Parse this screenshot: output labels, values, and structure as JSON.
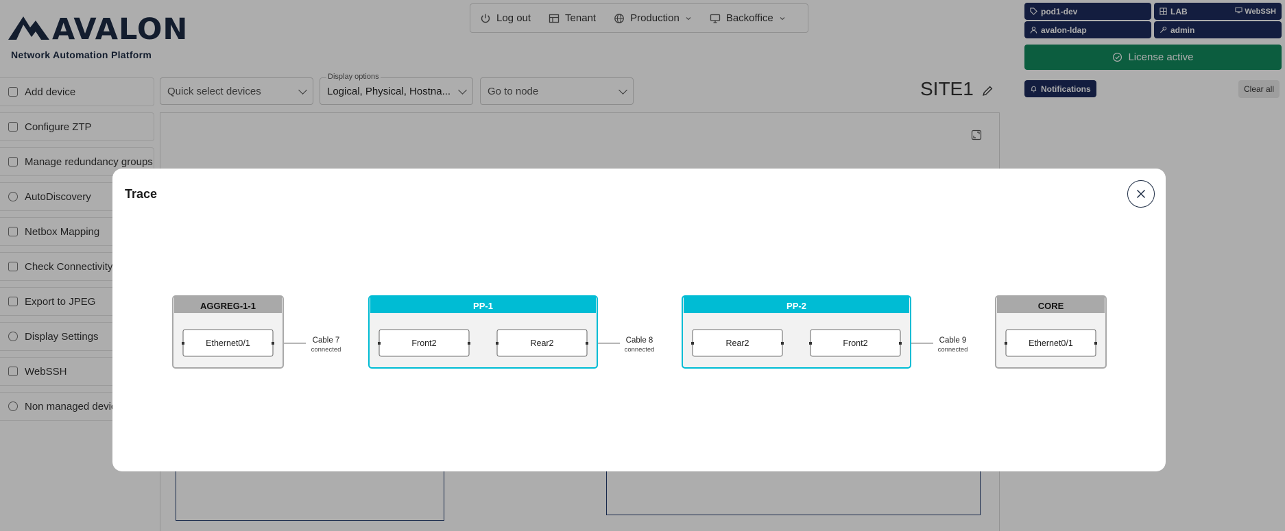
{
  "brand": {
    "name": "AVALON",
    "tagline": "Network Automation Platform"
  },
  "topnav": {
    "logout": "Log out",
    "tenant": "Tenant",
    "environment": "Production",
    "backoffice": "Backoffice"
  },
  "status": {
    "env_tag": "pod1-dev",
    "lab_tag": "LAB",
    "webssh": "WebSSH",
    "ldap_user": "avalon-ldap",
    "user": "admin",
    "license": "License active",
    "notifications": "Notifications",
    "clear_all": "Clear all"
  },
  "sidebar": {
    "items": [
      {
        "label": "Add device",
        "icon": "cart-icon"
      },
      {
        "label": "Configure ZTP",
        "icon": "link-icon"
      },
      {
        "label": "Manage redundancy groups",
        "icon": "copy-icon"
      },
      {
        "label": "AutoDiscovery",
        "icon": "check-circle-icon"
      },
      {
        "label": "Netbox Mapping",
        "icon": "list-icon"
      },
      {
        "label": "Check Connectivity",
        "icon": "check-square-icon"
      },
      {
        "label": "Export to JPEG",
        "icon": "image-icon"
      },
      {
        "label": "Display Settings",
        "icon": "gear-icon"
      },
      {
        "label": "WebSSH",
        "icon": "terminal-icon"
      },
      {
        "label": "Non managed devices",
        "icon": "eye-off-icon"
      }
    ]
  },
  "toolbar": {
    "quick_select": "Quick select devices",
    "display_options_label": "Display options",
    "display_options_value": "Logical, Physical, Hostna...",
    "goto_node": "Go to node"
  },
  "site": {
    "title": "SITE1"
  },
  "modal": {
    "title": "Trace",
    "nodes": [
      {
        "name": "AGGREG-1-1",
        "kind": "device",
        "ports": [
          "Ethernet0/1"
        ]
      },
      {
        "name": "PP-1",
        "kind": "patch-panel",
        "ports": [
          "Front2",
          "Rear2"
        ]
      },
      {
        "name": "PP-2",
        "kind": "patch-panel",
        "ports": [
          "Rear2",
          "Front2"
        ]
      },
      {
        "name": "CORE",
        "kind": "device",
        "ports": [
          "Ethernet0/1"
        ]
      }
    ],
    "cables": [
      {
        "label": "Cable 7",
        "status": "connected"
      },
      {
        "label": "Cable 8",
        "status": "connected"
      },
      {
        "label": "Cable 9",
        "status": "connected"
      }
    ],
    "colors": {
      "device_header": "#a9a9a9",
      "patch_panel_header": "#00bcd4",
      "node_fill": "#f2f2f2"
    }
  }
}
